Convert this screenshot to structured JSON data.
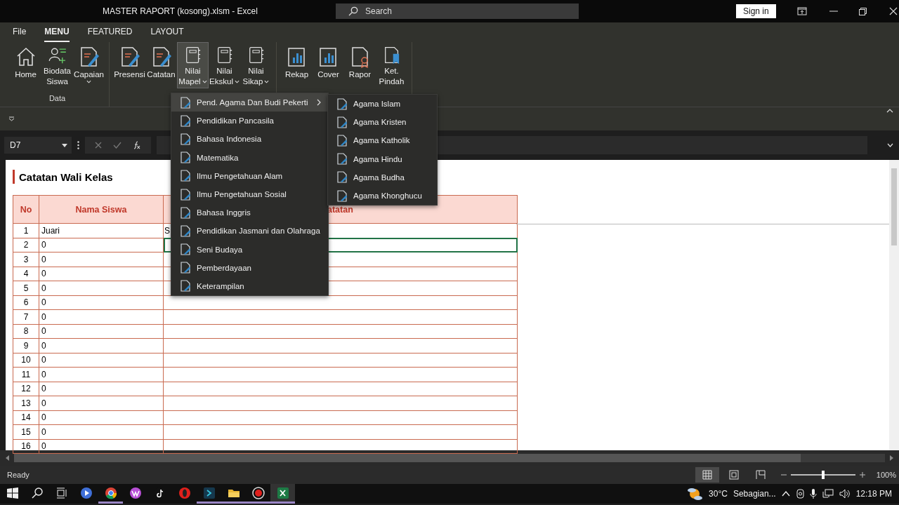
{
  "window": {
    "title": "MASTER RAPORT (kosong).xlsm  -  Excel",
    "search_placeholder": "Search",
    "sign_in": "Sign in"
  },
  "tabs": [
    {
      "label": "File",
      "selected": false
    },
    {
      "label": "MENU",
      "selected": true
    },
    {
      "label": "FEATURED",
      "selected": false
    },
    {
      "label": "LAYOUT",
      "selected": false
    }
  ],
  "ribbon": {
    "groups": [
      {
        "label": "Data",
        "buttons": [
          {
            "kind": "home",
            "lines": [
              "Home"
            ],
            "dropdown": false,
            "selected": false
          },
          {
            "kind": "person-add",
            "lines": [
              "Biodata",
              "Siswa"
            ],
            "dropdown": false,
            "selected": false
          },
          {
            "kind": "doc-pen",
            "lines": [
              "Capaian"
            ],
            "dropdown": true,
            "selected": false
          }
        ]
      },
      {
        "buttons": [
          {
            "kind": "doc-pen",
            "lines": [
              "Presensi"
            ],
            "dropdown": false,
            "selected": false
          },
          {
            "kind": "doc-pen",
            "lines": [
              "Catatan"
            ],
            "dropdown": false,
            "selected": false
          },
          {
            "kind": "book",
            "lines": [
              "Nilai",
              "Mapel"
            ],
            "dropdown": true,
            "selected": true
          },
          {
            "kind": "book",
            "lines": [
              "Nilai",
              "Ekskul"
            ],
            "dropdown": true,
            "selected": false
          },
          {
            "kind": "book",
            "lines": [
              "Nilai",
              "Sikap"
            ],
            "dropdown": true,
            "selected": false
          }
        ]
      },
      {
        "buttons": [
          {
            "kind": "chart",
            "lines": [
              "Rekap"
            ],
            "dropdown": false,
            "selected": false
          },
          {
            "kind": "chart",
            "lines": [
              "Cover"
            ],
            "dropdown": false,
            "selected": false
          },
          {
            "kind": "ribbon-doc",
            "lines": [
              "Rapor"
            ],
            "dropdown": false,
            "selected": false
          },
          {
            "kind": "bookmark-doc",
            "lines": [
              "Ket.",
              "Pindah"
            ],
            "dropdown": false,
            "selected": false
          }
        ]
      }
    ]
  },
  "formula_bar": {
    "name_box": "D7"
  },
  "sheet": {
    "title": "Catatan Wali Kelas",
    "columns": [
      "No",
      "Nama Siswa",
      "atatan"
    ],
    "rows": [
      {
        "no": "1",
        "name": "Juari",
        "note": "S",
        "selected": false
      },
      {
        "no": "2",
        "name": "0",
        "selected": true
      },
      {
        "no": "3",
        "name": "0",
        "selected": false
      },
      {
        "no": "4",
        "name": "0",
        "selected": false
      },
      {
        "no": "5",
        "name": "0",
        "selected": false
      },
      {
        "no": "6",
        "name": "0",
        "selected": false
      },
      {
        "no": "7",
        "name": "0",
        "selected": false
      },
      {
        "no": "8",
        "name": "0",
        "selected": false
      },
      {
        "no": "9",
        "name": "0",
        "selected": false
      },
      {
        "no": "10",
        "name": "0",
        "selected": false
      },
      {
        "no": "11",
        "name": "0",
        "selected": false
      },
      {
        "no": "12",
        "name": "0",
        "selected": false
      },
      {
        "no": "13",
        "name": "0",
        "selected": false
      },
      {
        "no": "14",
        "name": "0",
        "selected": false
      },
      {
        "no": "15",
        "name": "0",
        "selected": false
      },
      {
        "no": "16",
        "name": "0",
        "selected": false
      }
    ]
  },
  "menu": {
    "items": [
      {
        "label": "Pend. Agama Dan Budi Pekerti",
        "selected": true,
        "submenu": true
      },
      {
        "label": "Pendidikan Pancasila",
        "selected": false,
        "submenu": false
      },
      {
        "label": "Bahasa Indonesia",
        "selected": false,
        "submenu": false
      },
      {
        "label": "Matematika",
        "selected": false,
        "submenu": false
      },
      {
        "label": "Ilmu Pengetahuan Alam",
        "selected": false,
        "submenu": false
      },
      {
        "label": "Ilmu Pengetahuan Sosial",
        "selected": false,
        "submenu": false
      },
      {
        "label": "Bahasa Inggris",
        "selected": false,
        "submenu": false
      },
      {
        "label": "Pendidikan Jasmani dan Olahraga",
        "selected": false,
        "submenu": false
      },
      {
        "label": "Seni Budaya",
        "selected": false,
        "submenu": false
      },
      {
        "label": "Pemberdayaan",
        "selected": false,
        "submenu": false
      },
      {
        "label": "Keterampilan",
        "selected": false,
        "submenu": false
      }
    ]
  },
  "submenu": {
    "items": [
      {
        "label": "Agama Islam",
        "selected": false
      },
      {
        "label": "Agama Kristen",
        "selected": false
      },
      {
        "label": "Agama Katholik",
        "selected": false
      },
      {
        "label": "Agama Hindu",
        "selected": false
      },
      {
        "label": "Agama Budha",
        "selected": false
      },
      {
        "label": "Agama Khonghucu",
        "selected": false
      }
    ]
  },
  "status_bar": {
    "status": "Ready",
    "views": [
      {
        "kind": "normal",
        "selected": true
      },
      {
        "kind": "page-layout",
        "selected": false
      },
      {
        "kind": "page-break",
        "selected": false
      }
    ],
    "zoom": {
      "level": 0.5,
      "label": "100%"
    }
  },
  "taskbar": {
    "apps": [
      {
        "kind": "video",
        "active": false
      },
      {
        "kind": "chrome",
        "active": true
      },
      {
        "kind": "office",
        "active": false
      },
      {
        "kind": "tiktok",
        "active": false
      },
      {
        "kind": "opera",
        "active": false
      },
      {
        "kind": "editor",
        "active": true
      },
      {
        "kind": "folder",
        "active": true
      },
      {
        "kind": "recorder",
        "active": true
      },
      {
        "kind": "excel",
        "active": true
      }
    ],
    "temperature": "30°C",
    "weather": "Sebagian...",
    "time": "12:18 PM"
  }
}
